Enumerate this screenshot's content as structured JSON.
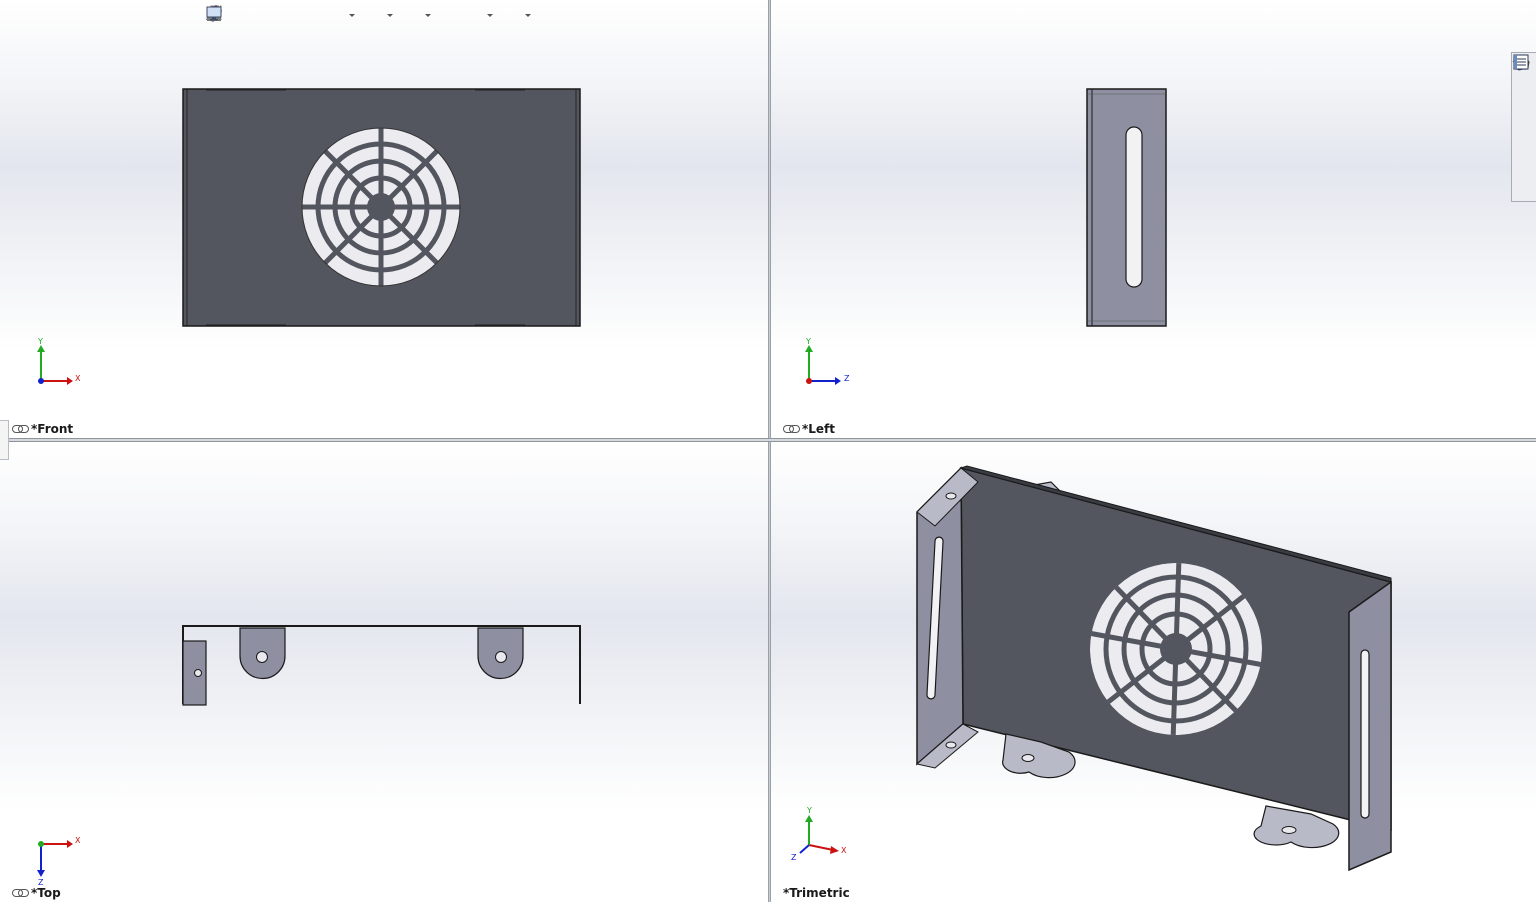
{
  "viewports": {
    "front": {
      "label": "*Front",
      "axis_h": "X",
      "axis_v": "Y"
    },
    "left": {
      "label": "*Left",
      "axis_h": "Z",
      "axis_v": "Y"
    },
    "top": {
      "label": "*Top",
      "axis_h": "X",
      "axis_v": "Z"
    },
    "trimetric": {
      "label": "*Trimetric",
      "axis_h": "X",
      "axis_v": "Y",
      "axis_d": "Z"
    }
  },
  "toolbar": {
    "icons": [
      "zoom-to-fit-icon",
      "zoom-to-area-icon",
      "previous-view-icon",
      "section-view-icon",
      "dynamic-annotation-icon",
      "view-orientation-icon",
      "display-style-icon",
      "hide-show-items-icon",
      "edit-appearance-icon",
      "apply-scene-icon",
      "view-settings-icon"
    ]
  },
  "task_pane": {
    "icons": [
      "solidworks-resources-icon",
      "design-library-icon",
      "file-explorer-icon",
      "view-palette-icon",
      "appearances-scenes-icon",
      "custom-properties-icon"
    ]
  },
  "colors": {
    "sheet_metal": "#53565f",
    "sheet_metal_light": "#8e90a2",
    "edge": "#1a1a1a",
    "axis_x": "#cc1111",
    "axis_y": "#22aa22",
    "axis_z": "#1122cc"
  }
}
